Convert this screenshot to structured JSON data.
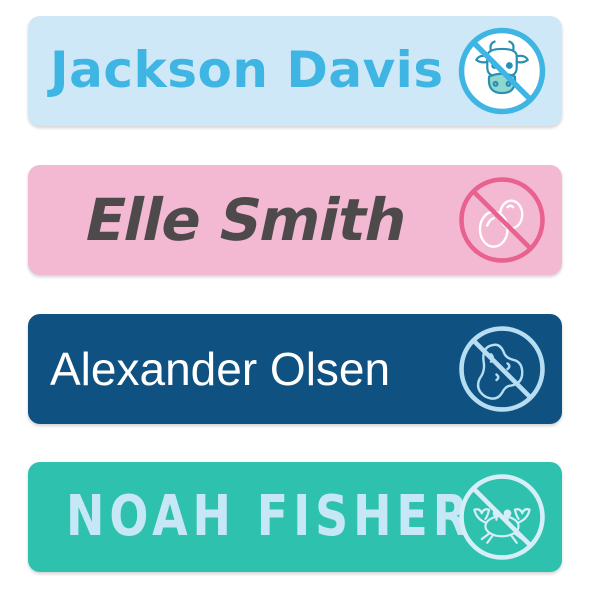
{
  "labels": [
    {
      "name": "Jackson Davis",
      "background": "#cfe8f7",
      "text_color": "#3fb5e3",
      "icon": "no-dairy-icon"
    },
    {
      "name": "Elle Smith",
      "background": "#f3b9d2",
      "text_color": "#4e4a4c",
      "icon": "no-egg-icon"
    },
    {
      "name": "Alexander Olsen",
      "background": "#0f5281",
      "text_color": "#ffffff",
      "icon": "no-peanut-icon"
    },
    {
      "name": "NOAH FISHER",
      "background": "#2ec1ae",
      "text_color": "#c6e8f6",
      "icon": "no-shellfish-icon"
    }
  ]
}
